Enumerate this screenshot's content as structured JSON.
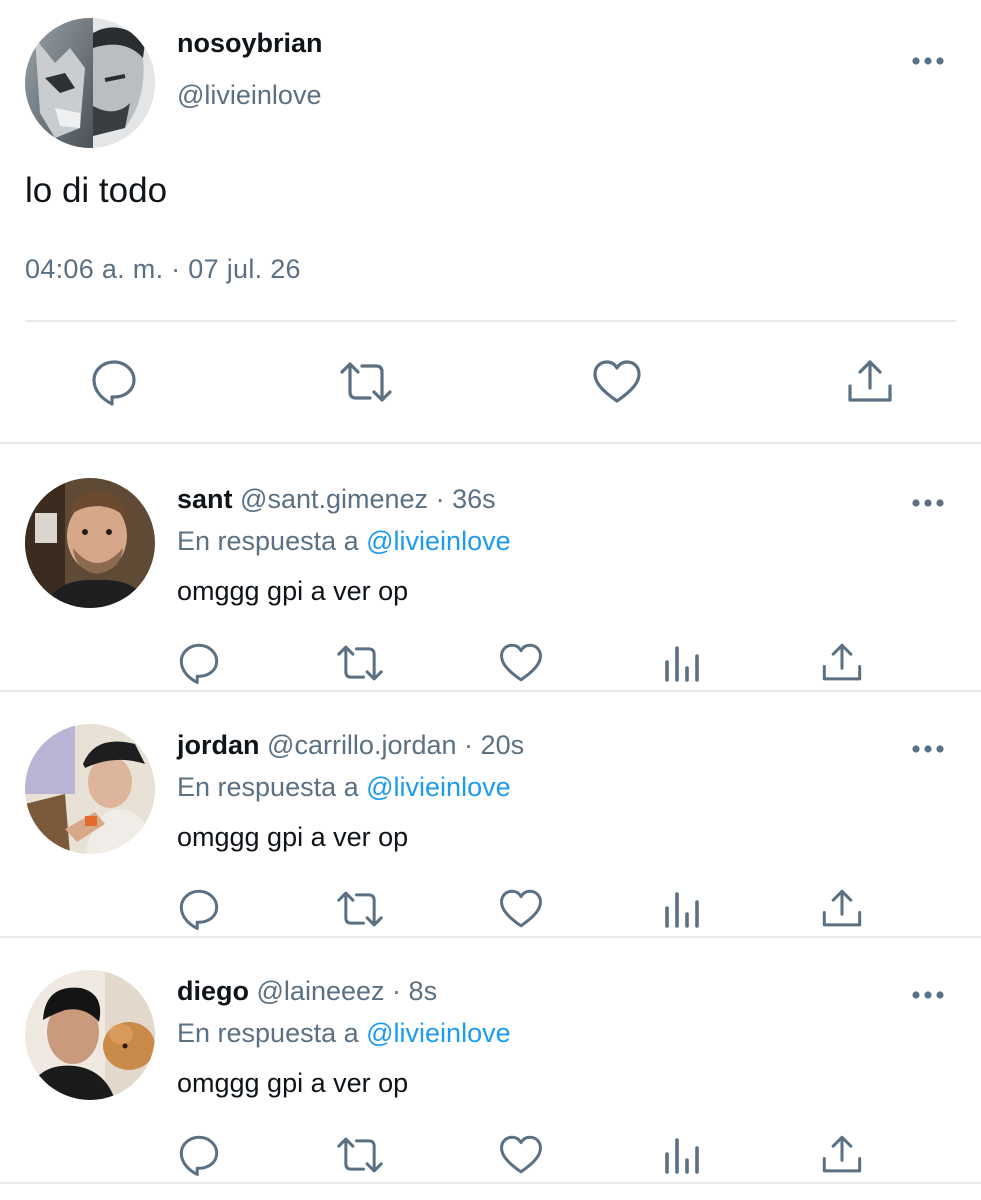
{
  "main_tweet": {
    "display_name": "nosoybrian",
    "handle": "@livieinlove",
    "text": "lo di todo",
    "timestamp": "04:06 a. m. · 07 jul. 26",
    "avatar": "wolf-face-avatar",
    "actions": [
      "reply-icon",
      "retweet-icon",
      "like-icon",
      "share-icon"
    ]
  },
  "replies": [
    {
      "display_name": "sant",
      "handle": "@sant.gimenez",
      "dot": "·",
      "time": "36s",
      "reply_prefix": "En respuesta a",
      "reply_mention": "@livieinlove",
      "text": "omggg gpi a ver op"
    },
    {
      "display_name": "jordan",
      "handle": "@carrillo.jordan",
      "dot": "·",
      "time": "20s",
      "reply_prefix": "En respuesta a",
      "reply_mention": "@livieinlove",
      "text": "omggg gpi a ver op"
    },
    {
      "display_name": "diego",
      "handle": "@laineeez",
      "dot": "·",
      "time": "8s",
      "reply_prefix": "En respuesta a",
      "reply_mention": "@livieinlove",
      "text": "omggg gpi a ver op"
    }
  ],
  "colors": {
    "text": "#0f1419",
    "secondary": "#5b7083",
    "mention": "#1d9bf0",
    "divider": "#e6e9eb"
  }
}
